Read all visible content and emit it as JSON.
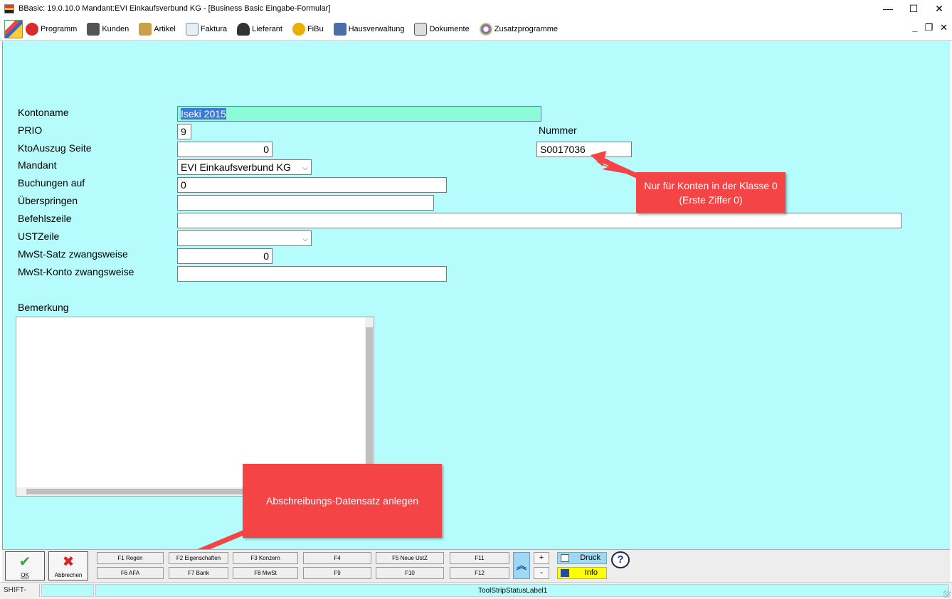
{
  "window": {
    "title": "BBasic: 19.0.10.0 Mandant:EVI Einkaufsverbund KG - [Business Basic Eingabe-Formular]",
    "minimize": "—",
    "maximize": "☐",
    "close": "✕"
  },
  "menu": {
    "items": [
      {
        "label": "Programm",
        "icon": "programm-icon",
        "color": "#d92b2b"
      },
      {
        "label": "Kunden",
        "icon": "kunden-icon",
        "color": "#555555"
      },
      {
        "label": "Artikel",
        "icon": "artikel-icon",
        "color": "#c9a14a"
      },
      {
        "label": "Faktura",
        "icon": "faktura-icon",
        "color": "#6a8db8"
      },
      {
        "label": "Lieferant",
        "icon": "lieferant-icon",
        "color": "#333333"
      },
      {
        "label": "FiBu",
        "icon": "fibu-icon",
        "color": "#e8b000"
      },
      {
        "label": "Hausverwaltung",
        "icon": "hausverwaltung-icon",
        "color": "#4a6fa5"
      },
      {
        "label": "Dokumente",
        "icon": "dokumente-icon",
        "color": "#555555"
      },
      {
        "label": "Zusatzprogramme",
        "icon": "zusatzprogramme-icon",
        "color": "#cc44aa"
      }
    ],
    "mdi_minimize": "_",
    "mdi_restore": "❐",
    "mdi_close": "✕"
  },
  "form": {
    "labels": {
      "kontoname": "Kontoname",
      "prio": "PRIO",
      "ktoauszug": "KtoAuszug Seite",
      "mandant": "Mandant",
      "buchungen": "Buchungen auf",
      "ueberspringen": "Überspringen",
      "befehlszeile": "Befehlszeile",
      "ustzeile": "USTZeile",
      "mwst_satz": "MwSt-Satz zwangsweise",
      "mwst_konto": "MwSt-Konto zwangsweise",
      "nummer": "Nummer",
      "bemerkung": "Bemerkung"
    },
    "values": {
      "kontoname": "Iseki 2015",
      "prio": "9",
      "ktoauszug": "0",
      "mandant": "EVI Einkaufsverbund KG",
      "buchungen": "0",
      "ueberspringen": "",
      "befehlszeile": "",
      "ustzeile": "",
      "mwst_satz": "0",
      "mwst_konto": "",
      "nummer": "S0017036",
      "bemerkung": ""
    },
    "colors": {
      "background": "#b6fcfd",
      "highlighted_field": "#8cfcd8"
    }
  },
  "callouts": {
    "nummer_hint": "Nur für Konten in der Klasse 0 (Erste Ziffer 0)",
    "afa_hint": "Abschreibungs-Datensatz anlegen",
    "color": "#f44446"
  },
  "buttons": {
    "ok": "OK",
    "abbrechen": "Abbrechen",
    "fkeys_row1": [
      "F1 Regen",
      "F2 Eigenschaften",
      "F3 Konzern",
      "F4",
      "F5 Neue UstZ",
      "F11"
    ],
    "fkeys_row2": [
      "F6 AFA",
      "F7 Bank",
      "F8 MwSt",
      "F9",
      "F10",
      "F12"
    ],
    "plus": "+",
    "minus": "-",
    "druck": "Druck",
    "info": "Info",
    "help": "?"
  },
  "status": {
    "shift": "SHIFT-Taste",
    "label": "ToolStripStatusLabel1"
  }
}
